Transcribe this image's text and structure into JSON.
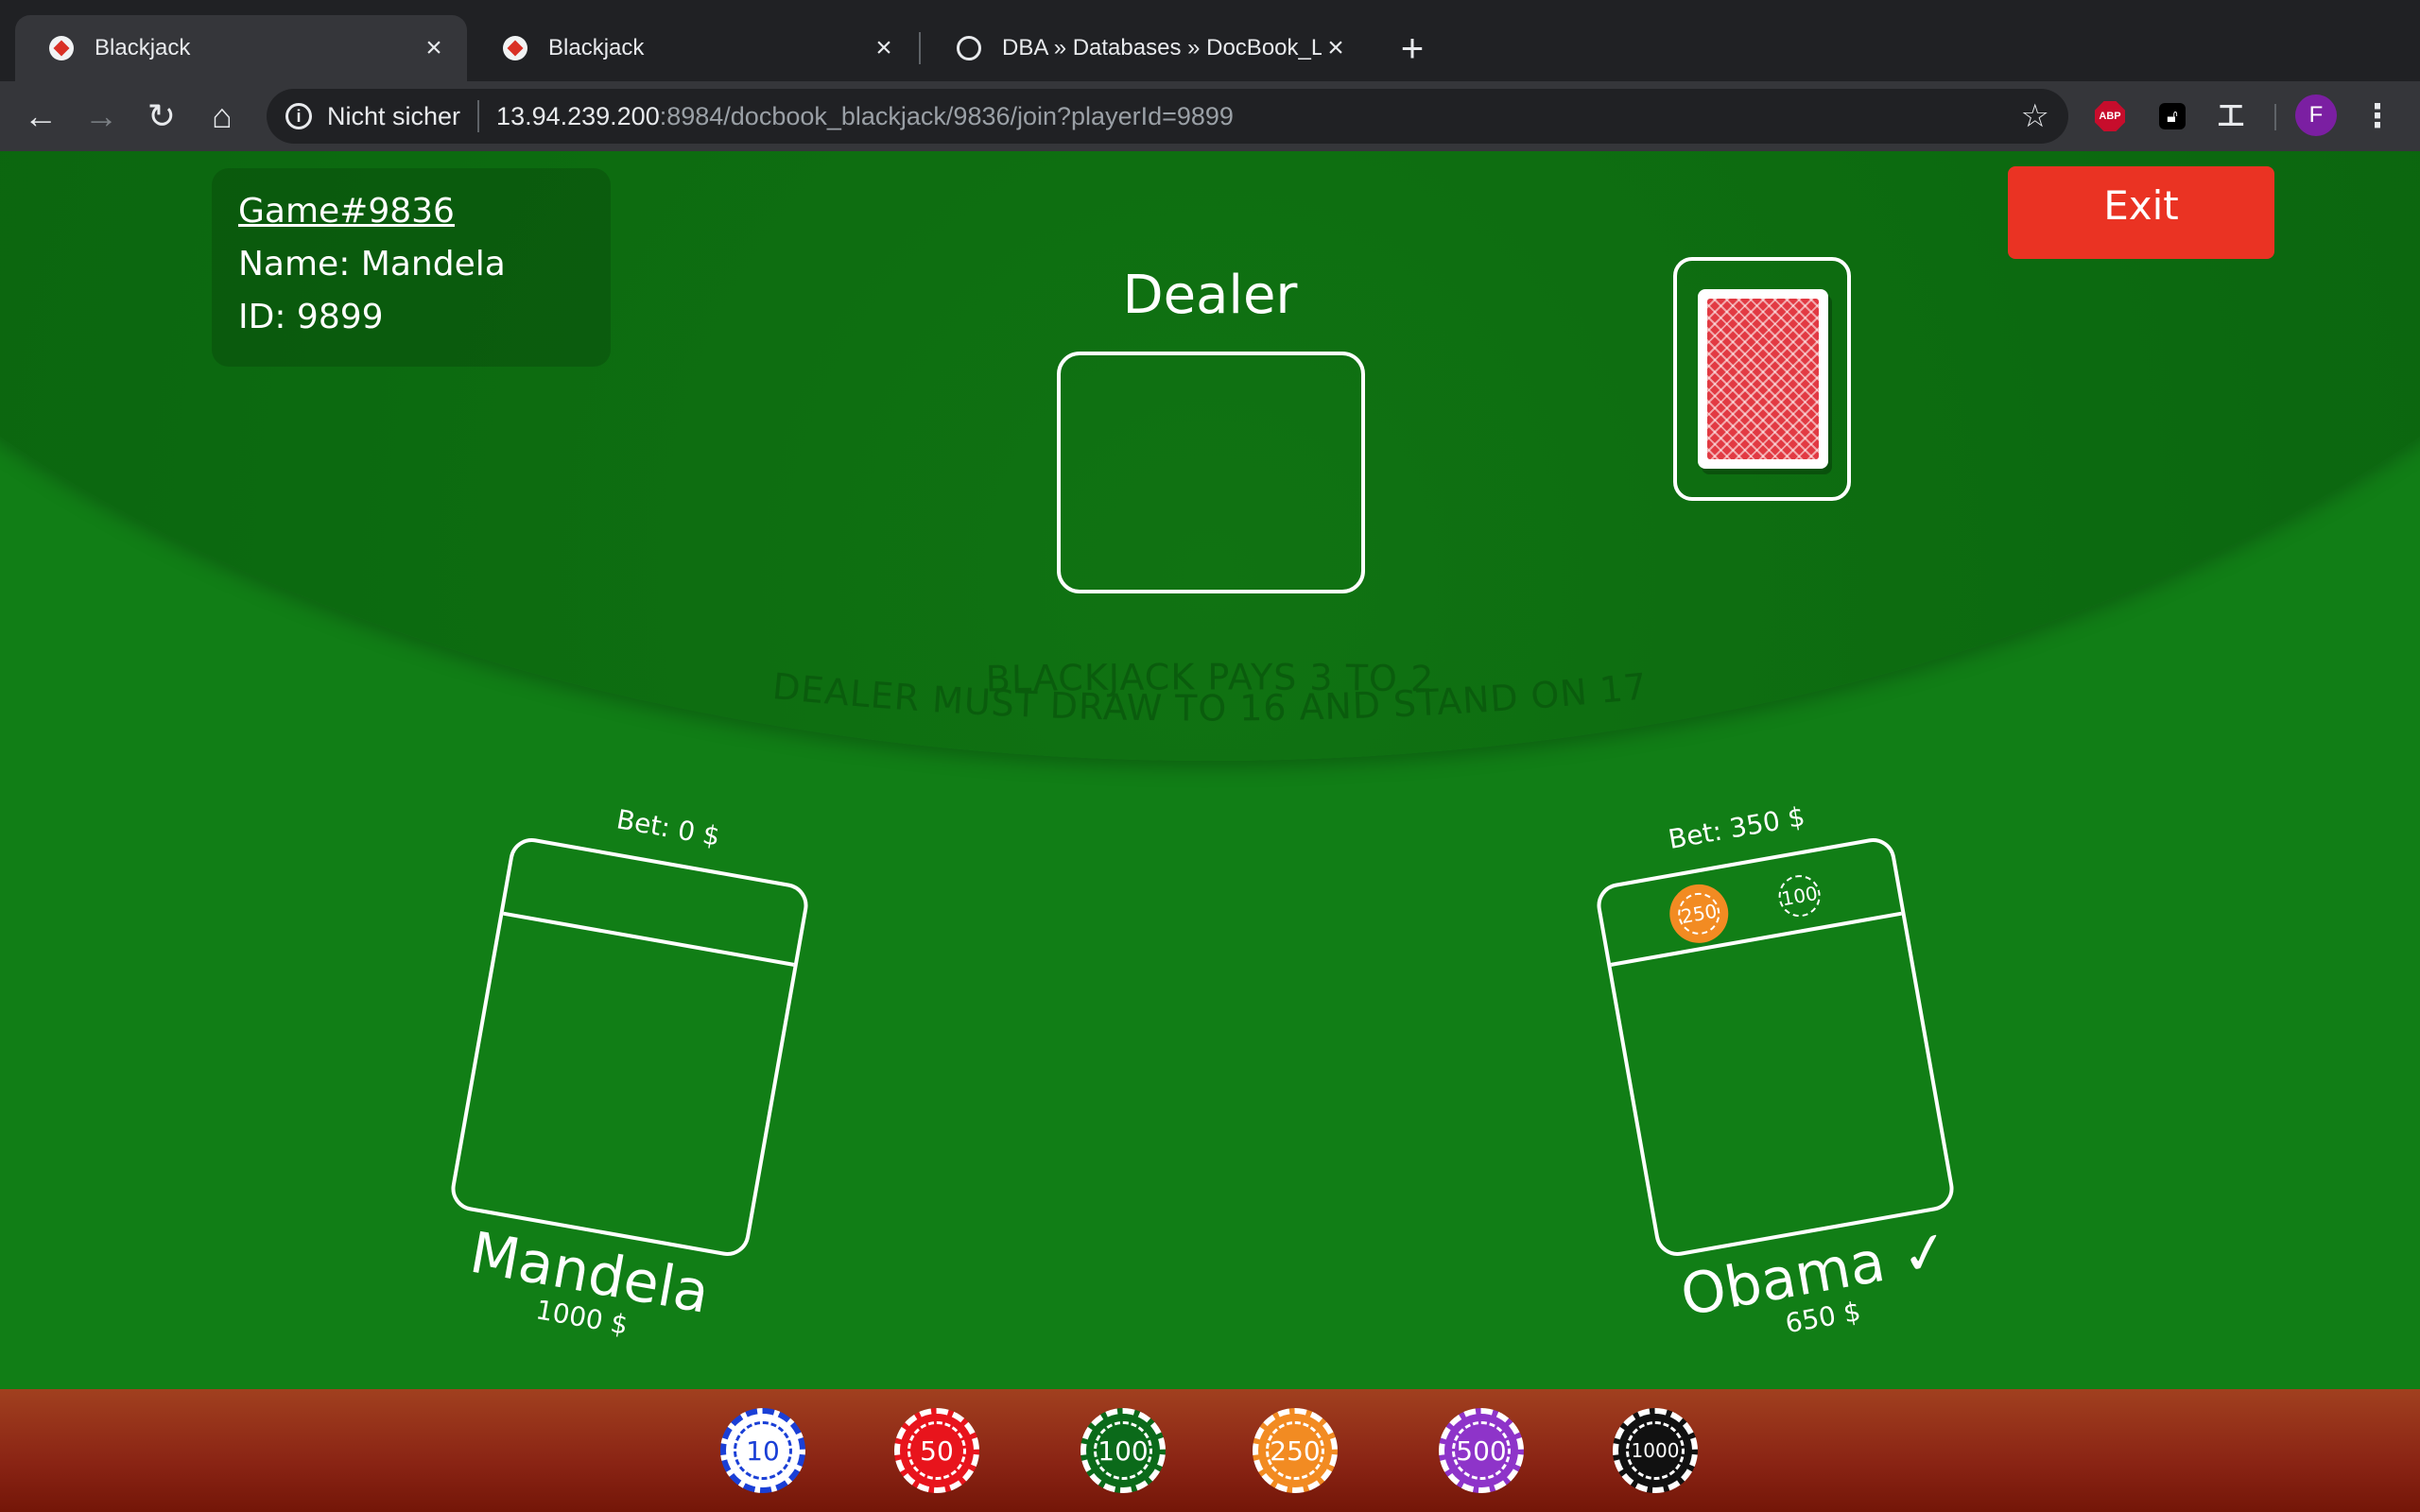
{
  "tabs": [
    {
      "title": "Blackjack",
      "active": true
    },
    {
      "title": "Blackjack",
      "active": false
    },
    {
      "title": "DBA » Databases » DocBook_Lo",
      "active": false
    }
  ],
  "address_bar": {
    "security_label": "Nicht sicher",
    "url_host": "13.94.239.200",
    "url_rest": ":8984/docbook_blackjack/9836/join?playerId=9899"
  },
  "profile": {
    "initial": "F"
  },
  "game": {
    "game_id": "Game#9836",
    "player_name": "Name: Mandela",
    "player_id": "ID: 9899",
    "exit_label": "Exit",
    "dealer_label": "Dealer",
    "rules": [
      "BLACKJACK PAYS 3 TO 2",
      "DEALER MUST DRAW TO 16 AND STAND ON 17"
    ]
  },
  "seats": {
    "left": {
      "bet": "Bet: 0 $",
      "name": "Mandela",
      "money": "1000 $"
    },
    "right": {
      "bet": "Bet: 350 $",
      "name": "Obama ✓",
      "money": "650 $",
      "chips": [
        "250",
        "100"
      ]
    }
  },
  "chips": [
    {
      "label": "10",
      "color": "#1a3fd6",
      "text": "#1a3fd6",
      "face": "#ffffff"
    },
    {
      "label": "50",
      "color": "#e8141c",
      "text": "#ffffff",
      "face": "#e8141c"
    },
    {
      "label": "100",
      "color": "#0b6a1a",
      "text": "#ffffff",
      "face": "#0b6a1a"
    },
    {
      "label": "250",
      "color": "#f28b22",
      "text": "#ffffff",
      "face": "#f28b22"
    },
    {
      "label": "500",
      "color": "#8e34c9",
      "text": "#ffffff",
      "face": "#8e34c9"
    },
    {
      "label": "1000",
      "color": "#111111",
      "text": "#ffffff",
      "face": "#111111"
    }
  ]
}
